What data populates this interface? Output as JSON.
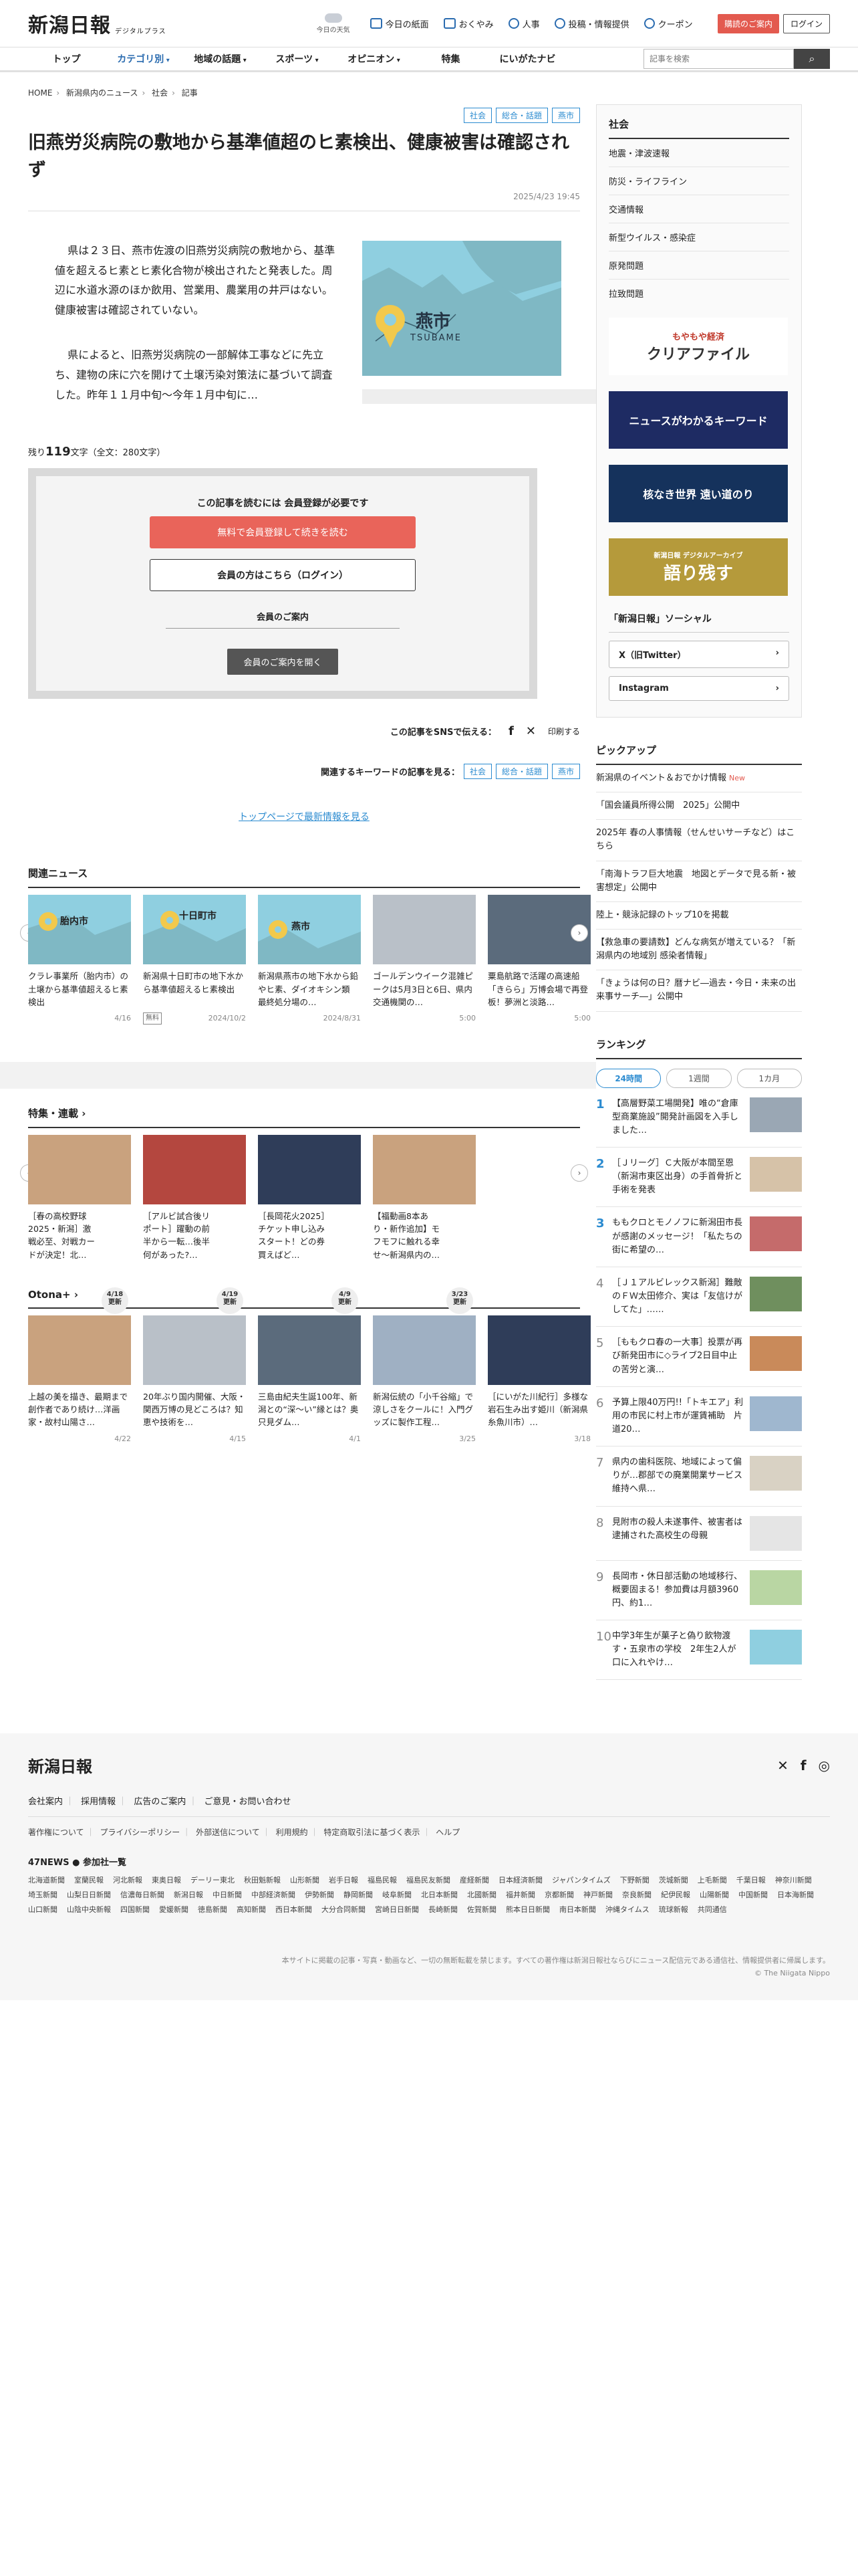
{
  "header": {
    "logo": "新潟日報",
    "logo_sub": "デジタルプラス",
    "weather_label": "今日の天気",
    "toplinks": [
      "今日の紙面",
      "おくやみ",
      "人事",
      "投稿・情報提供",
      "クーポン"
    ],
    "btn_signup": "購読のご案内",
    "btn_login": "ログイン"
  },
  "nav": {
    "items": [
      "トップ",
      "カテゴリ別",
      "地域の話題",
      "スポーツ",
      "オピニオン",
      "特集",
      "にいがたナビ"
    ],
    "search_placeholder": "記事を検索"
  },
  "breadcrumb": [
    "HOME",
    "新潟県内のニュース",
    "社会",
    "記事"
  ],
  "article": {
    "tags": [
      "社会",
      "総合・話題",
      "燕市"
    ],
    "title": "旧燕労災病院の敷地から基準値超のヒ素検出、健康被害は確認されず",
    "date": "2025/4/23 19:45",
    "p1": "県は２３日、燕市佐渡の旧燕労災病院の敷地から、基準値を超えるヒ素とヒ素化合物が検出されたと発表した。周辺に水道水源のほか飲用、営業用、農業用の井戸はない。健康被害は確認されていない。",
    "p2": "県によると、旧燕労災病院の一部解体工事などに先立ち、建物の床に穴を開けて土壌汚染対策法に基づいて調査した。昨年１１月中旬〜今年１月中旬に…",
    "map_city": "燕市",
    "map_city_en": "TSUBAME",
    "remain_prefix": "残り",
    "remain_count": "119",
    "remain_suffix": "文字（全文：280文字）"
  },
  "gate": {
    "heading": "この記事を読むには 会員登録が必要です",
    "signup_btn": "無料で会員登録して続きを読む",
    "login_btn": "会員の方はこちら（ログイン）",
    "guide_title": "会員のご案内",
    "guide_btn": "会員のご案内を開く"
  },
  "share": {
    "label": "この記事をSNSで伝える：",
    "print": "印刷する",
    "kw_label": "関連するキーワードの記事を見る：",
    "kw_tags": [
      "社会",
      "総合・話題",
      "燕市"
    ],
    "back_top": "トップページで最新情報を見る"
  },
  "related": {
    "title": "関連ニュース",
    "cards": [
      {
        "text": "クラレ事業所（胎内市）の土壌から基準値超えるヒ素検出",
        "date": "4/16",
        "badge": "",
        "map_label": "胎内市"
      },
      {
        "text": "新潟県十日町市の地下水から基準値超えるヒ素検出",
        "date": "2024/10/2",
        "badge": "無料",
        "map_label": "十日町市"
      },
      {
        "text": "新潟県燕市の地下水から鉛やヒ素、ダイオキシン類　最終処分場の…",
        "date": "2024/8/31",
        "badge": "",
        "map_label": "燕市"
      },
      {
        "text": "ゴールデンウイーク混雑ピークは5月3日と6日、県内交通機関の…",
        "date": "5:00",
        "badge": "",
        "map_label": ""
      },
      {
        "text": "粟島航路で活躍の高速船「きらら」万博会場で再登板！夢洲と淡路…",
        "date": "5:00",
        "badge": "",
        "map_label": ""
      }
    ]
  },
  "features": {
    "title": "特集・連載",
    "update_label": "更新",
    "cards": [
      {
        "text": "［春の高校野球2025・新潟］激戦必至、対戦カードが決定！北…",
        "date": "4/18"
      },
      {
        "text": "［アルビ試合後リポート］躍動の前半から一転…後半何があった?…",
        "date": "4/19"
      },
      {
        "text": "［長岡花火2025］チケット申し込みスタート！どの券買えばど…",
        "date": "4/9"
      },
      {
        "text": "【福動画8本あり・新作追加】モフモフに触れる幸せ〜新潟県内の…",
        "date": "3/23"
      }
    ]
  },
  "otona": {
    "title": "Otona+",
    "cards": [
      {
        "text": "上越の美を描き、最期まで創作者であり続け…洋画家・故村山陽さ…",
        "date": "4/22"
      },
      {
        "text": "20年ぶり国内開催、大阪・関西万博の見どころは？知恵や技術を…",
        "date": "4/15"
      },
      {
        "text": "三島由紀夫生誕100年、新潟との“深〜い”縁とは？奥只見ダム…",
        "date": "4/1"
      },
      {
        "text": "新潟伝統の「小千谷縮」で涼しさをクールに！入門グッズに製作工程…",
        "date": "3/25"
      },
      {
        "text": "［にいがた川紀行］多様な岩石生み出す姫川（新潟県糸魚川市）…",
        "date": "3/18"
      }
    ]
  },
  "sidebar": {
    "cat_title": "社会",
    "cat_items": [
      "地震・津波速報",
      "防災・ライフライン",
      "交通情報",
      "新型ウイルス・感染症",
      "原発問題",
      "拉致問題"
    ],
    "banners": [
      "クリアファイル",
      "ニュースがわかるキーワード",
      "核なき世界 遠い道のり",
      "語り残す"
    ],
    "banner_small": [
      "もやもや経済",
      "",
      "",
      "新潟日報 デジタルアーカイブ"
    ],
    "social_title": "「新潟日報」ソーシャル",
    "social": [
      "X（旧Twitter）",
      "Instagram"
    ],
    "pickup_title": "ピックアップ",
    "pickup": [
      {
        "text": "新潟県のイベント＆おでかけ情報",
        "new": "New"
      },
      {
        "text": "「国会議員所得公開　2025」公開中",
        "new": ""
      },
      {
        "text": "2025年 春の人事情報（せんせいサーチなど）はこちら",
        "new": ""
      },
      {
        "text": "「南海トラフ巨大地震　地図とデータで見る新・被害想定」公開中",
        "new": ""
      },
      {
        "text": "陸上・競泳記録のトップ10を掲載",
        "new": ""
      },
      {
        "text": "【救急車の要請数】どんな病気が増えている？「新潟県内の地域別 感染者情報」",
        "new": ""
      },
      {
        "text": "「きょうは何の日？暦ナビ―過去・今日・未来の出来事サーチ―」公開中",
        "new": ""
      }
    ],
    "ranking_title": "ランキング",
    "ranking_tabs": [
      "24時間",
      "1週間",
      "1カ月"
    ],
    "ranking": [
      "【高層野菜工場開発】唯の“倉庫型商業施設”開発計画図を入手しました…",
      "［Ｊリーグ］Ｃ大阪が本間至恩（新潟市東区出身）の手首骨折と手術を発表",
      "ももクロとモノノフに新潟田市長が感謝のメッセージ！「私たちの街に希望の…",
      "［Ｊ１アルビレックス新潟］難敵のＦＷ太田修介、実は「友信けがしてた」……",
      "［ももクロ春の一大事］投票が再び新発田市に◇ライブ2日目中止の苦労と演…",
      "予算上限40万円!!「トキエア」利用の市民に村上市が運賃補助　片道20…",
      "県内の歯科医院、地域によって偏りが…郡部での廃業開業サービス維持へ県…",
      "見附市の殺人未遂事件、被害者は逮捕された高校生の母親",
      "長岡市・休日部活動の地域移行、概要固まる！参加費は月額3960円、約1…",
      "中学3年生が菓子と偽り飲物渡す・五泉市の学校　2年生2人が口に入れやけ…"
    ]
  },
  "footer": {
    "logo": "新潟日報",
    "links": [
      "会社案内",
      "採用情報",
      "広告のご案内",
      "ご意見・お問い合わせ"
    ],
    "links2": [
      "著作権について",
      "プライバシーポリシー",
      "外部送信について",
      "利用規約",
      "特定商取引法に基づく表示",
      "ヘルプ"
    ],
    "news47": "47NEWS ● 参加社一覧",
    "papers": [
      "北海道新聞",
      "室蘭民報",
      "河北新報",
      "東奥日報",
      "デーリー東北",
      "秋田魁新報",
      "山形新聞",
      "岩手日報",
      "福島民報",
      "福島民友新聞",
      "産経新聞",
      "日本経済新聞",
      "ジャパンタイムズ",
      "下野新聞",
      "茨城新聞",
      "上毛新聞",
      "千葉日報",
      "神奈川新聞",
      "埼玉新聞",
      "山梨日日新聞",
      "信濃毎日新聞",
      "新潟日報",
      "中日新聞",
      "中部経済新聞",
      "伊勢新聞",
      "静岡新聞",
      "岐阜新聞",
      "北日本新聞",
      "北國新聞",
      "福井新聞",
      "京都新聞",
      "神戸新聞",
      "奈良新聞",
      "紀伊民報",
      "山陽新聞",
      "中国新聞",
      "日本海新聞",
      "山口新聞",
      "山陰中央新報",
      "四国新聞",
      "愛媛新聞",
      "徳島新聞",
      "高知新聞",
      "西日本新聞",
      "大分合同新聞",
      "宮崎日日新聞",
      "長崎新聞",
      "佐賀新聞",
      "熊本日日新聞",
      "南日本新聞",
      "沖縄タイムス",
      "琉球新報",
      "共同通信"
    ],
    "copyright": "本サイトに掲載の記事・写真・動画など、一切の無断転載を禁じます。すべての著作権は新潟日報社ならびにニュース配信元である通信社、情報提供者に帰属します。",
    "copyright2": "© The Niigata Nippo"
  },
  "colors": {
    "accent": "#2b8bd0",
    "signup": "#e9645a",
    "map_sea": "#8fcfe0"
  }
}
